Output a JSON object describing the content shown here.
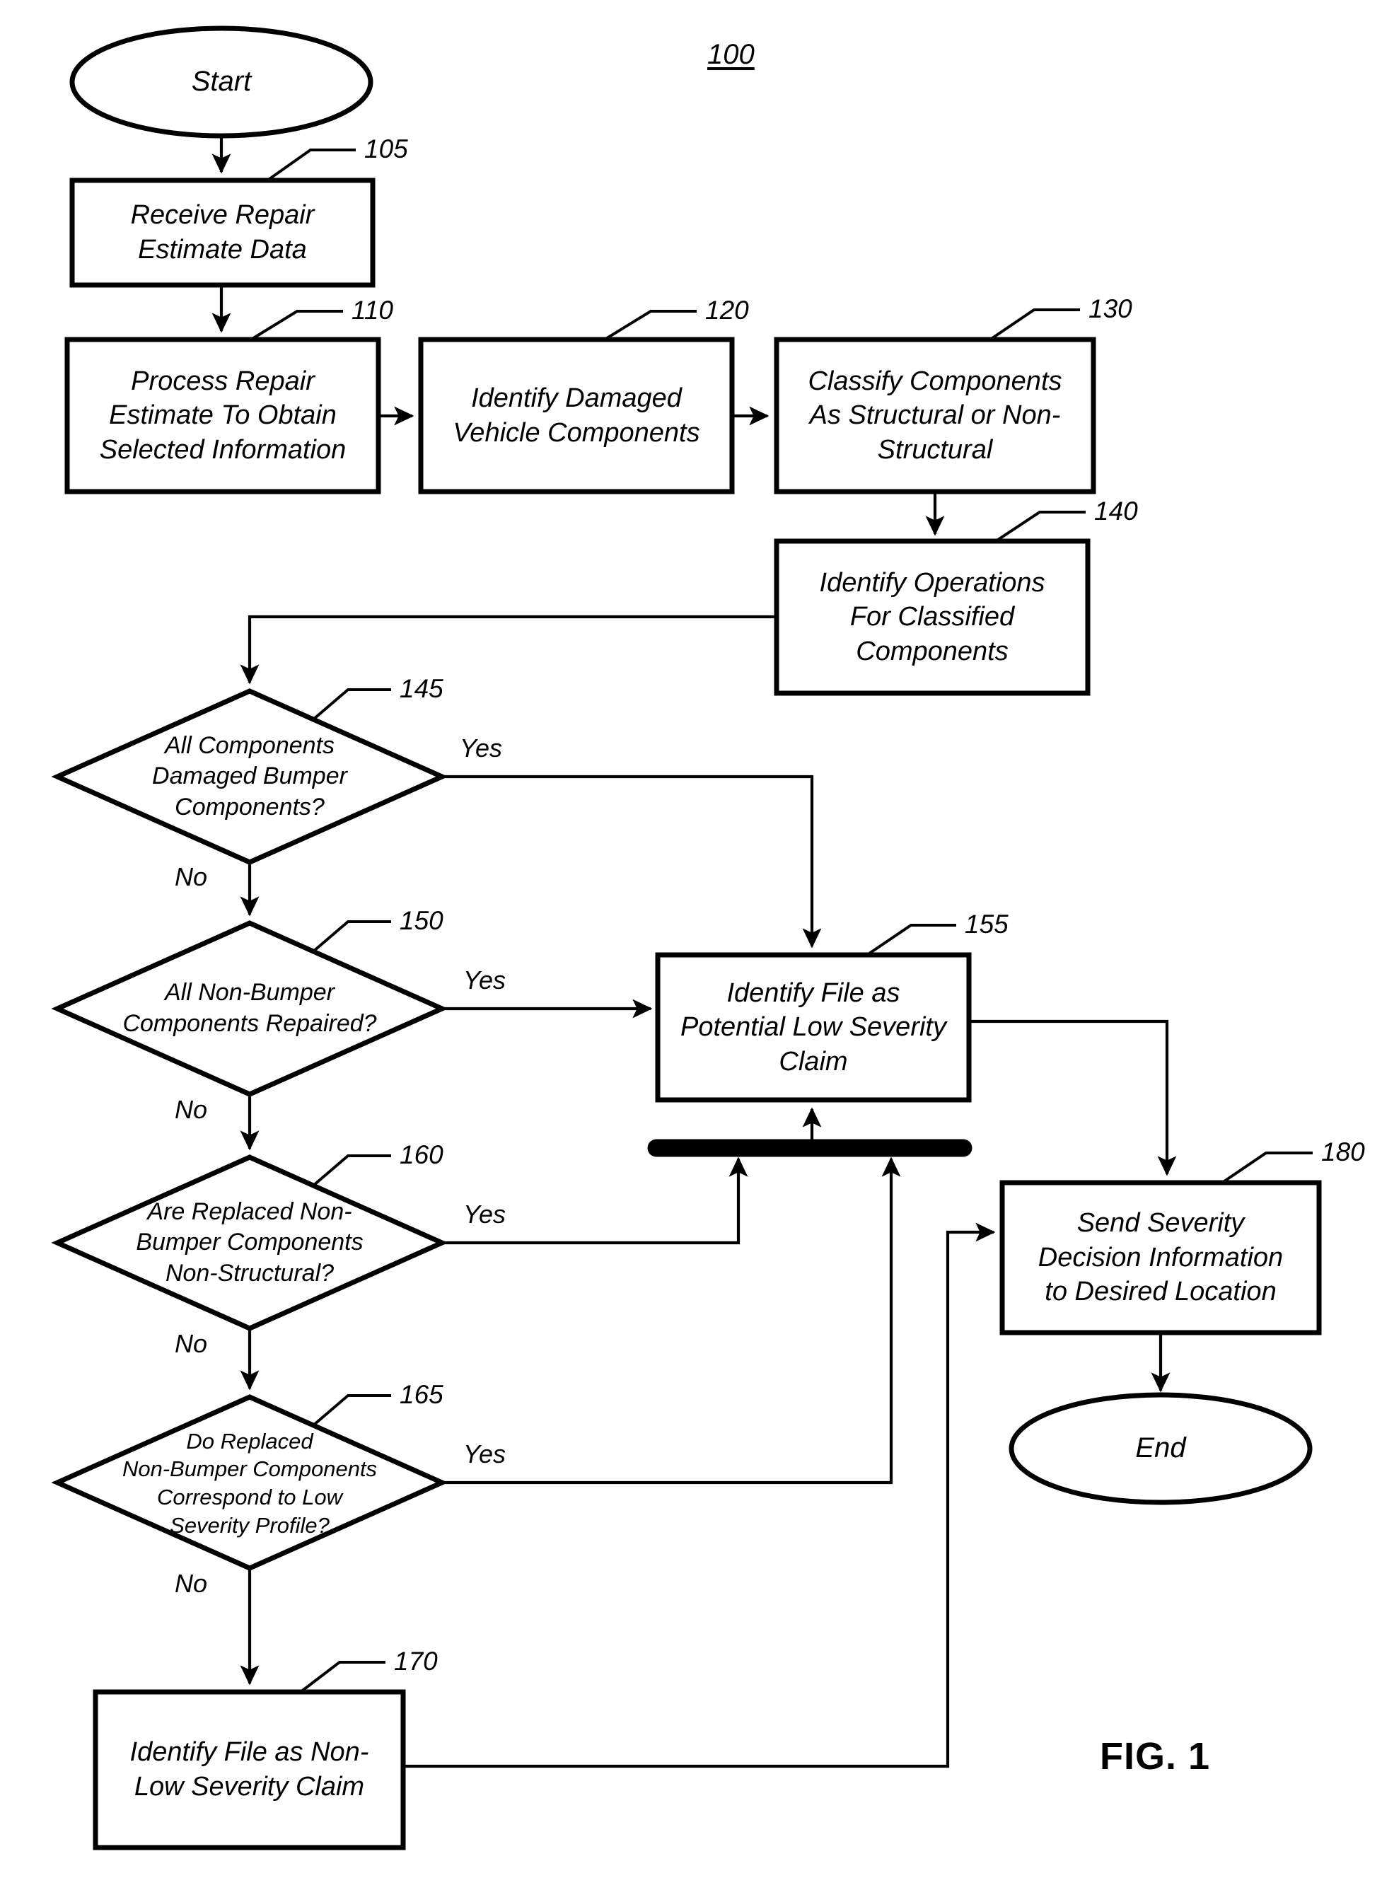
{
  "figure": {
    "label": "FIG. 1",
    "diagram_number": "100",
    "line_color": "#000000",
    "background_color": "#ffffff"
  },
  "nodes": {
    "start": {
      "ref": "",
      "text": "Start",
      "shape": "ellipse"
    },
    "n105": {
      "ref": "105",
      "text": "Receive Repair\nEstimate Data",
      "shape": "process"
    },
    "n110": {
      "ref": "110",
      "text": "Process Repair\nEstimate To Obtain\nSelected Information",
      "shape": "process"
    },
    "n120": {
      "ref": "120",
      "text": "Identify Damaged\nVehicle Components",
      "shape": "process"
    },
    "n130": {
      "ref": "130",
      "text": "Classify Components\nAs Structural or Non-\nStructural",
      "shape": "process"
    },
    "n140": {
      "ref": "140",
      "text": "Identify Operations\nFor Classified\nComponents",
      "shape": "process"
    },
    "n145": {
      "ref": "145",
      "text": "All Components\nDamaged Bumper\nComponents?",
      "shape": "decision"
    },
    "n150": {
      "ref": "150",
      "text": "All Non-Bumper\nComponents Repaired?",
      "shape": "decision"
    },
    "n155": {
      "ref": "155",
      "text": "Identify File as\nPotential Low Severity\nClaim",
      "shape": "process"
    },
    "n160": {
      "ref": "160",
      "text": "Are Replaced Non-\nBumper Components\nNon-Structural?",
      "shape": "decision"
    },
    "n165": {
      "ref": "165",
      "text": "Do Replaced\nNon-Bumper Components\nCorrespond to Low\nSeverity Profile?",
      "shape": "decision"
    },
    "n170": {
      "ref": "170",
      "text": "Identify File as Non-\nLow Severity Claim",
      "shape": "process"
    },
    "n180": {
      "ref": "180",
      "text": "Send Severity\nDecision Information\nto Desired Location",
      "shape": "process"
    },
    "end": {
      "ref": "",
      "text": "End",
      "shape": "ellipse"
    }
  },
  "edge_labels": {
    "yes145": "Yes",
    "no145": "No",
    "yes150": "Yes",
    "no150": "No",
    "yes160": "Yes",
    "no160": "No",
    "yes165": "Yes",
    "no165": "No"
  }
}
